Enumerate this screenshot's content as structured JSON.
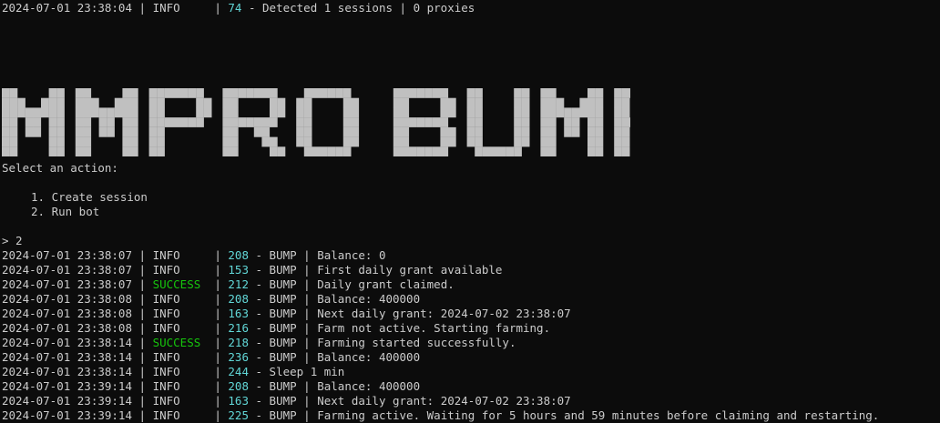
{
  "header_log": {
    "timestamp": "2024-07-01 23:38:04",
    "level": "INFO",
    "line_no": "74",
    "message": "Detected 1 sessions | 0 proxies"
  },
  "banner_text": "MMPRO BUMP",
  "menu": {
    "prompt": "Select an action:",
    "options": [
      "1. Create session",
      "2. Run bot"
    ],
    "input_prompt": "> 2"
  },
  "colors": {
    "background": "#0c0c0c",
    "text": "#cccccc",
    "line_number": "#61d6d6",
    "success": "#16c60c",
    "banner": "#c0c0c0"
  },
  "logs": [
    {
      "ts": "2024-07-01 23:38:07",
      "level": "INFO",
      "ln": "208",
      "msg": "BUMP | Balance: 0"
    },
    {
      "ts": "2024-07-01 23:38:07",
      "level": "INFO",
      "ln": "153",
      "msg": "BUMP | First daily grant available"
    },
    {
      "ts": "2024-07-01 23:38:07",
      "level": "SUCCESS",
      "ln": "212",
      "msg": "BUMP | Daily grant claimed."
    },
    {
      "ts": "2024-07-01 23:38:08",
      "level": "INFO",
      "ln": "208",
      "msg": "BUMP | Balance: 400000"
    },
    {
      "ts": "2024-07-01 23:38:08",
      "level": "INFO",
      "ln": "163",
      "msg": "BUMP | Next daily grant: 2024-07-02 23:38:07"
    },
    {
      "ts": "2024-07-01 23:38:08",
      "level": "INFO",
      "ln": "216",
      "msg": "BUMP | Farm not active. Starting farming."
    },
    {
      "ts": "2024-07-01 23:38:14",
      "level": "SUCCESS",
      "ln": "218",
      "msg": "BUMP | Farming started successfully."
    },
    {
      "ts": "2024-07-01 23:38:14",
      "level": "INFO",
      "ln": "236",
      "msg": "BUMP | Balance: 400000"
    },
    {
      "ts": "2024-07-01 23:38:14",
      "level": "INFO",
      "ln": "244",
      "msg": "Sleep 1 min"
    },
    {
      "ts": "2024-07-01 23:39:14",
      "level": "INFO",
      "ln": "208",
      "msg": "BUMP | Balance: 400000"
    },
    {
      "ts": "2024-07-01 23:39:14",
      "level": "INFO",
      "ln": "163",
      "msg": "BUMP | Next daily grant: 2024-07-02 23:38:07"
    },
    {
      "ts": "2024-07-01 23:39:14",
      "level": "INFO",
      "ln": "225",
      "msg": "BUMP | Farming active. Waiting for 5 hours and 59 minutes before claiming and restarting."
    }
  ]
}
